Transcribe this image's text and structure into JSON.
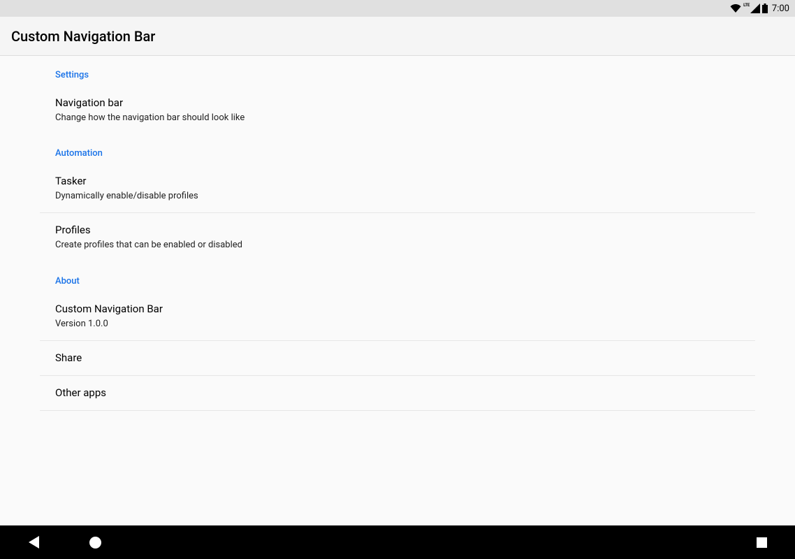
{
  "status": {
    "time": "7:00",
    "lte": "LTE"
  },
  "appBar": {
    "title": "Custom Navigation Bar"
  },
  "sections": [
    {
      "header": "Settings",
      "items": [
        {
          "title": "Navigation bar",
          "subtitle": "Change how the navigation bar should look like",
          "dividerAfter": false
        }
      ]
    },
    {
      "header": "Automation",
      "items": [
        {
          "title": "Tasker",
          "subtitle": "Dynamically enable/disable profiles",
          "dividerAfter": true
        },
        {
          "title": "Profiles",
          "subtitle": "Create profiles that can be enabled or disabled",
          "dividerAfter": false
        }
      ]
    },
    {
      "header": "About",
      "items": [
        {
          "title": "Custom Navigation Bar",
          "subtitle": "Version 1.0.0",
          "dividerAfter": true
        },
        {
          "title": "Share",
          "dividerAfter": true
        },
        {
          "title": "Other apps",
          "dividerAfter": true
        }
      ]
    }
  ]
}
